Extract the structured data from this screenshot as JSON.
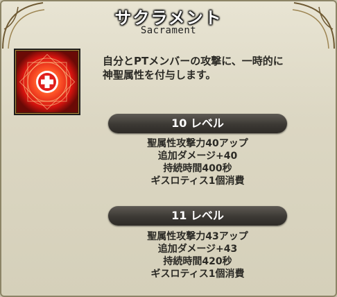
{
  "skill": {
    "name": "サクラメント",
    "name_en": "Sacrament",
    "icon": "holy-cross-icon",
    "description": [
      "自分とPTメンバーの攻撃に、一時的に",
      "神聖属性を付与します。"
    ]
  },
  "levels": [
    {
      "title": "10 レベル",
      "effects": [
        "聖属性攻撃力40アップ",
        "追加ダメージ+40",
        "持続時間400秒",
        "ギスロティス1個消費"
      ]
    },
    {
      "title": "11 レベル",
      "effects": [
        "聖属性攻撃力43アップ",
        "追加ダメージ+43",
        "持続時間420秒",
        "ギスロティス1個消費"
      ]
    }
  ],
  "colors": {
    "title_text": "#ffffff",
    "level_bar": "#3c3934",
    "icon_red": "#e0201c",
    "frame_gold": "#b78c3c"
  }
}
